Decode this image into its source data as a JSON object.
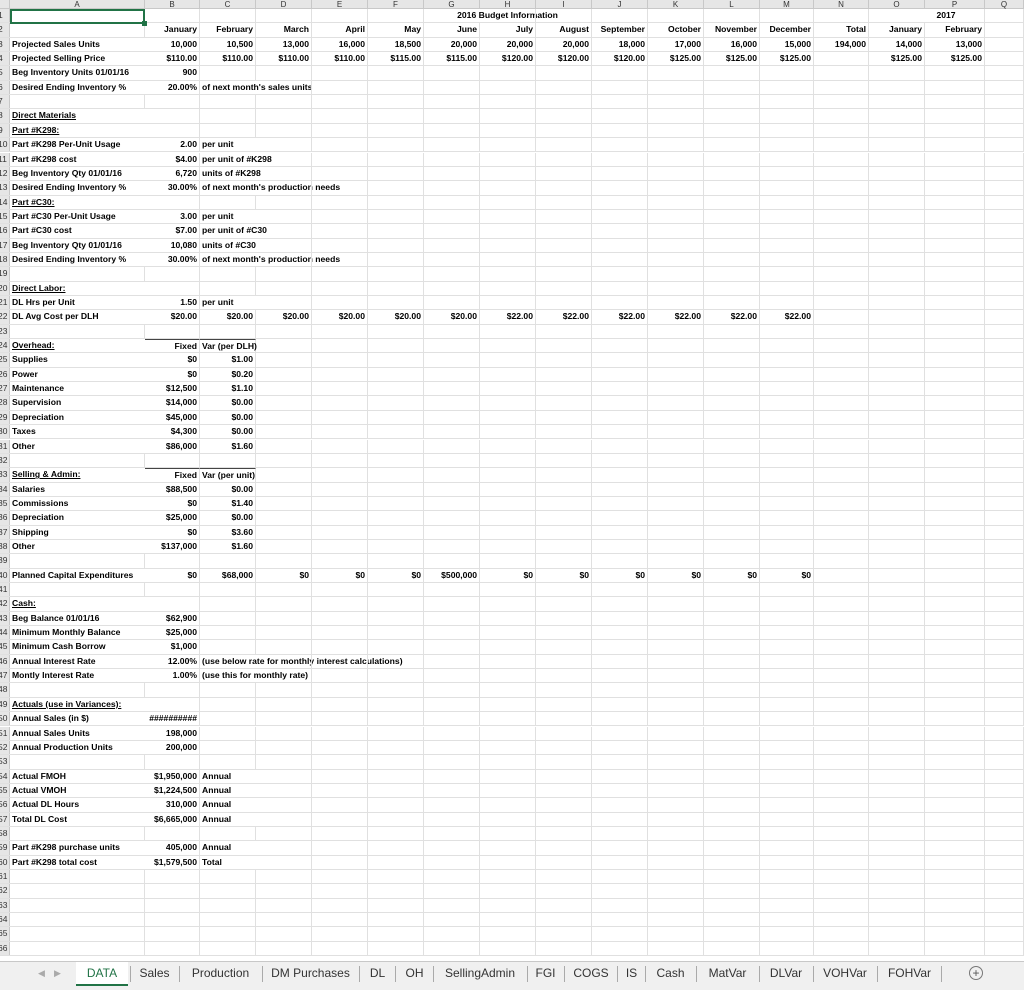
{
  "columns": [
    "A",
    "B",
    "C",
    "D",
    "E",
    "F",
    "G",
    "H",
    "I",
    "J",
    "K",
    "L",
    "M",
    "N",
    "O",
    "P",
    "Q"
  ],
  "row_count": 66,
  "cells": {
    "G1": "2016 Budget Information",
    "O1": "2017",
    "B2": "January",
    "C2": "February",
    "D2": "March",
    "E2": "April",
    "F2": "May",
    "G2": "June",
    "H2": "July",
    "I2": "August",
    "J2": "September",
    "K2": "October",
    "L2": "November",
    "M2": "December",
    "N2": "Total",
    "O2": "January",
    "P2": "February",
    "A3": "Projected Sales Units",
    "B3": "10,000",
    "C3": "10,500",
    "D3": "13,000",
    "E3": "16,000",
    "F3": "18,500",
    "G3": "20,000",
    "H3": "20,000",
    "I3": "20,000",
    "J3": "18,000",
    "K3": "17,000",
    "L3": "16,000",
    "M3": "15,000",
    "N3": "194,000",
    "O3": "14,000",
    "P3": "13,000",
    "A4": "Projected Selling Price",
    "B4": "$110.00",
    "C4": "$110.00",
    "D4": "$110.00",
    "E4": "$110.00",
    "F4": "$115.00",
    "G4": "$115.00",
    "H4": "$120.00",
    "I4": "$120.00",
    "J4": "$120.00",
    "K4": "$125.00",
    "L4": "$125.00",
    "M4": "$125.00",
    "O4": "$125.00",
    "P4": "$125.00",
    "A5": "Beg Inventory Units 01/01/16",
    "B5": "900",
    "A6": "Desired Ending Inventory %",
    "B6": "20.00%",
    "C6": "of next month's sales units",
    "A8": "Direct Materials",
    "A9": "Part #K298:",
    "A10": "Part #K298 Per-Unit Usage",
    "B10": "2.00",
    "C10": "per unit",
    "A11": "Part #K298 cost",
    "B11": "$4.00",
    "C11": "per unit of #K298",
    "A12": "Beg Inventory Qty 01/01/16",
    "B12": "6,720",
    "C12": "units of #K298",
    "A13": "Desired Ending Inventory %",
    "B13": "30.00%",
    "C13": "of next month's production needs",
    "A14": "Part #C30:",
    "A15": "Part #C30 Per-Unit Usage",
    "B15": "3.00",
    "C15": "per unit",
    "A16": "Part #C30 cost",
    "B16": "$7.00",
    "C16": "per unit of #C30",
    "A17": "Beg Inventory Qty 01/01/16",
    "B17": "10,080",
    "C17": "units of #C30",
    "A18": "Desired Ending Inventory %",
    "B18": "30.00%",
    "C18": "of next month's production needs",
    "A20": "Direct Labor:",
    "A21": "DL Hrs per Unit",
    "B21": "1.50",
    "C21": "per unit",
    "A22": "DL Avg Cost per DLH",
    "B22": "$20.00",
    "C22": "$20.00",
    "D22": "$20.00",
    "E22": "$20.00",
    "F22": "$20.00",
    "G22": "$20.00",
    "H22": "$22.00",
    "I22": "$22.00",
    "J22": "$22.00",
    "K22": "$22.00",
    "L22": "$22.00",
    "M22": "$22.00",
    "A24": "Overhead:",
    "B24": "Fixed",
    "C24": "Var (per DLH)",
    "A25": "Supplies",
    "B25": "$0",
    "C25": "$1.00",
    "A26": "Power",
    "B26": "$0",
    "C26": "$0.20",
    "A27": "Maintenance",
    "B27": "$12,500",
    "C27": "$1.10",
    "A28": "Supervision",
    "B28": "$14,000",
    "C28": "$0.00",
    "A29": "Depreciation",
    "B29": "$45,000",
    "C29": "$0.00",
    "A30": "Taxes",
    "B30": "$4,300",
    "C30": "$0.00",
    "A31": "Other",
    "B31": "$86,000",
    "C31": "$1.60",
    "A33": "Selling & Admin:",
    "B33": "Fixed",
    "C33": "Var (per unit)",
    "A34": "Salaries",
    "B34": "$88,500",
    "C34": "$0.00",
    "A35": "Commissions",
    "B35": "$0",
    "C35": "$1.40",
    "A36": "Depreciation",
    "B36": "$25,000",
    "C36": "$0.00",
    "A37": "Shipping",
    "B37": "$0",
    "C37": "$3.60",
    "A38": "Other",
    "B38": "$137,000",
    "C38": "$1.60",
    "A40": "Planned Capital Expenditures",
    "B40": "$0",
    "C40": "$68,000",
    "D40": "$0",
    "E40": "$0",
    "F40": "$0",
    "G40": "$500,000",
    "H40": "$0",
    "I40": "$0",
    "J40": "$0",
    "K40": "$0",
    "L40": "$0",
    "M40": "$0",
    "A42": "Cash:",
    "A43": "Beg Balance 01/01/16",
    "B43": "$62,900",
    "A44": "Minimum Monthly Balance",
    "B44": "$25,000",
    "A45": "Minimum Cash Borrow",
    "B45": "$1,000",
    "A46": "Annual Interest Rate",
    "B46": "12.00%",
    "C46": "(use below rate for monthly interest calculations)",
    "A47": "Montly Interest Rate",
    "B47": "1.00%",
    "C47": "(use this for monthly rate)",
    "A49": "Actuals (use in Variances):",
    "A50": "Annual Sales (in $)",
    "B50": "##########",
    "A51": "Annual Sales Units",
    "B51": "198,000",
    "A52": "Annual Production Units",
    "B52": "200,000",
    "A54": "Actual FMOH",
    "B54": "$1,950,000",
    "C54": "Annual",
    "A55": "Actual VMOH",
    "B55": "$1,224,500",
    "C55": "Annual",
    "A56": "Actual DL Hours",
    "B56": "310,000",
    "C56": "Annual",
    "A57": "Total DL Cost",
    "B57": "$6,665,000",
    "C57": "Annual",
    "A59": "Part #K298 purchase units",
    "B59": "405,000",
    "C59": "Annual",
    "A60": "Part #K298 total cost",
    "B60": "$1,579,500",
    "C60": "Total"
  },
  "sheet_tabs": [
    "DATA",
    "Sales",
    "Production",
    "DM Purchases",
    "DL",
    "OH",
    "SellingAdmin",
    "FGI",
    "COGS",
    "IS",
    "Cash",
    "MatVar",
    "DLVar",
    "VOHVar",
    "FOHVar"
  ],
  "active_tab": "DATA",
  "selected_cell": "A1",
  "accent_color": "#217346"
}
